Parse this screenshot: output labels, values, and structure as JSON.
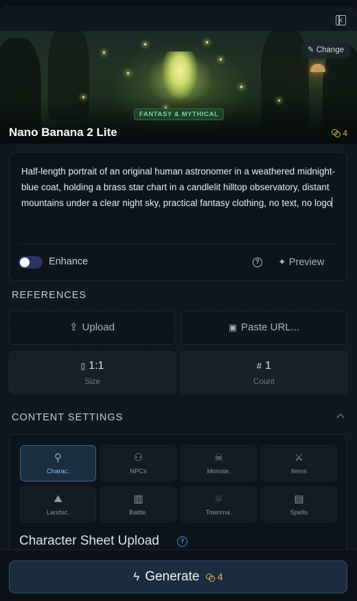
{
  "hero": {
    "change_label": "Change",
    "badge": "FANTASY & MYTHICAL",
    "model_name": "Nano Banana 2 Lite",
    "credits": "4"
  },
  "prompt": {
    "text": "Half-length portrait of an original human astronomer in a weathered midnight-blue coat, holding a brass star chart in a candlelit hilltop observatory, distant mountains under a clear night sky, practical fantasy clothing, no text, no logo",
    "enhance_label": "Enhance",
    "enhance_on": false,
    "help_glyph": "?",
    "preview_label": "Preview"
  },
  "references": {
    "heading": "REFERENCES",
    "upload_label": "Upload",
    "paste_label": "Paste URL...",
    "size_value": "1:1",
    "size_label": "Size",
    "count_value": "1",
    "count_label": "Count"
  },
  "content_settings": {
    "heading": "CONTENT SETTINGS",
    "categories": [
      {
        "label": "Charac.",
        "icon": "person-icon",
        "active": true
      },
      {
        "label": "NPCs",
        "icon": "users-icon",
        "active": false
      },
      {
        "label": "Monste.",
        "icon": "skull-icon",
        "active": false
      },
      {
        "label": "Items",
        "icon": "swords-icon",
        "active": false
      },
      {
        "label": "Landsc.",
        "icon": "mountain-icon",
        "active": false
      },
      {
        "label": "Battle.",
        "icon": "map-icon",
        "active": false
      },
      {
        "label": "Townma.",
        "icon": "map-pin-icon",
        "active": false
      },
      {
        "label": "Spells",
        "icon": "book-icon",
        "active": false
      }
    ],
    "sheet_title": "Character Sheet Upload"
  },
  "footer": {
    "generate_label": "Generate",
    "credits": "4"
  },
  "colors": {
    "accent": "#7fb1da",
    "credit": "#e4b94b",
    "badge_text": "#7fd39a"
  }
}
